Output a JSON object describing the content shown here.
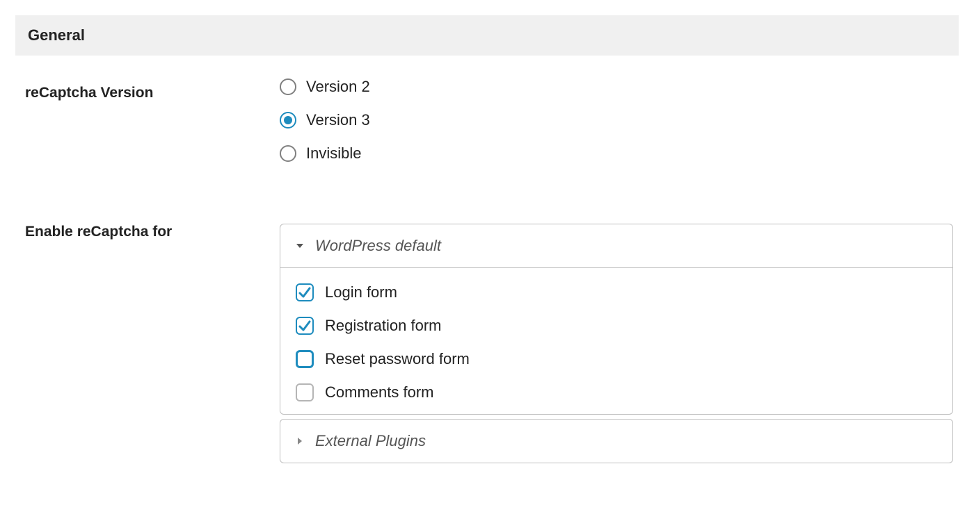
{
  "section": {
    "title": "General"
  },
  "version": {
    "label": "reCaptcha Version",
    "options": [
      {
        "label": "Version 2",
        "selected": false
      },
      {
        "label": "Version 3",
        "selected": true
      },
      {
        "label": "Invisible",
        "selected": false
      }
    ]
  },
  "enable": {
    "label": "Enable reCaptcha for",
    "panels": [
      {
        "title": "WordPress default",
        "open": true,
        "items": [
          {
            "label": "Login form",
            "checked": true,
            "highlight": false
          },
          {
            "label": "Registration form",
            "checked": true,
            "highlight": false
          },
          {
            "label": "Reset password form",
            "checked": false,
            "highlight": true
          },
          {
            "label": "Comments form",
            "checked": false,
            "highlight": false
          }
        ]
      },
      {
        "title": "External Plugins",
        "open": false,
        "items": []
      }
    ]
  }
}
